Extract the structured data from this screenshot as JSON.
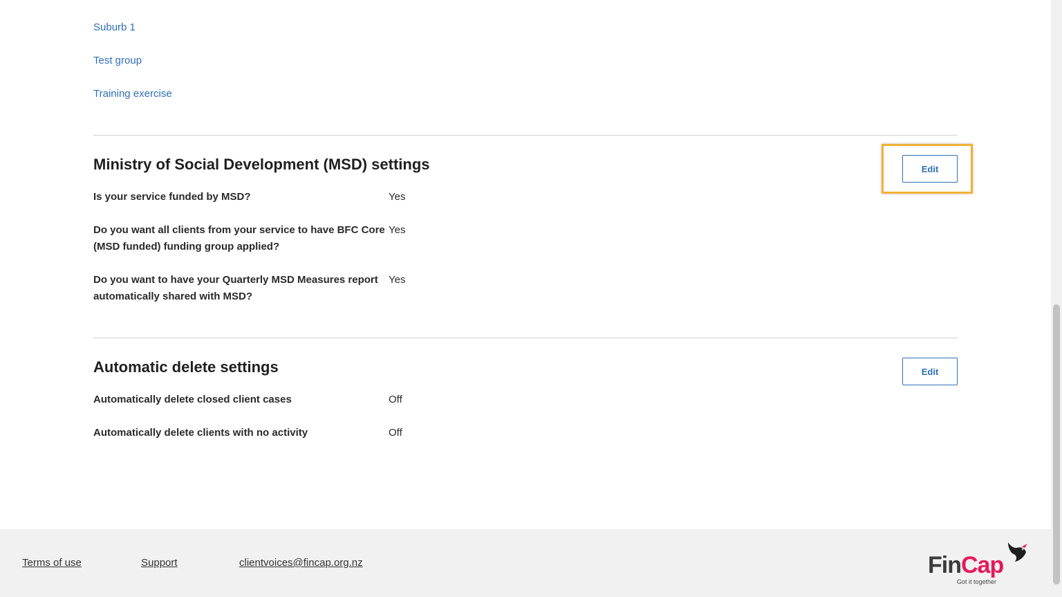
{
  "groups": {
    "items": [
      "Suburb 1",
      "Test group",
      "Training exercise"
    ]
  },
  "msd": {
    "title": "Ministry of Social Development (MSD) settings",
    "edit_label": "Edit",
    "rows": [
      {
        "question": "Is your service funded by MSD?",
        "answer": "Yes"
      },
      {
        "question": "Do you want all clients from your service to have BFC Core (MSD funded) funding group applied?",
        "answer": "Yes"
      },
      {
        "question": "Do you want to have your Quarterly MSD Measures report automatically shared with MSD?",
        "answer": "Yes"
      }
    ]
  },
  "auto_delete": {
    "title": "Automatic delete settings",
    "edit_label": "Edit",
    "rows": [
      {
        "question": "Automatically delete closed client cases",
        "answer": "Off"
      },
      {
        "question": "Automatically delete clients with no activity",
        "answer": "Off"
      }
    ]
  },
  "footer": {
    "terms": "Terms of use",
    "support": "Support",
    "email": "clientvoices@fincap.org.nz",
    "logo_fin": "Fin",
    "logo_cap": "Cap",
    "logo_tagline": "Got it together"
  },
  "colors": {
    "link": "#2f6fb5",
    "highlight": "#f2b134",
    "brand_pink": "#e6195a"
  }
}
